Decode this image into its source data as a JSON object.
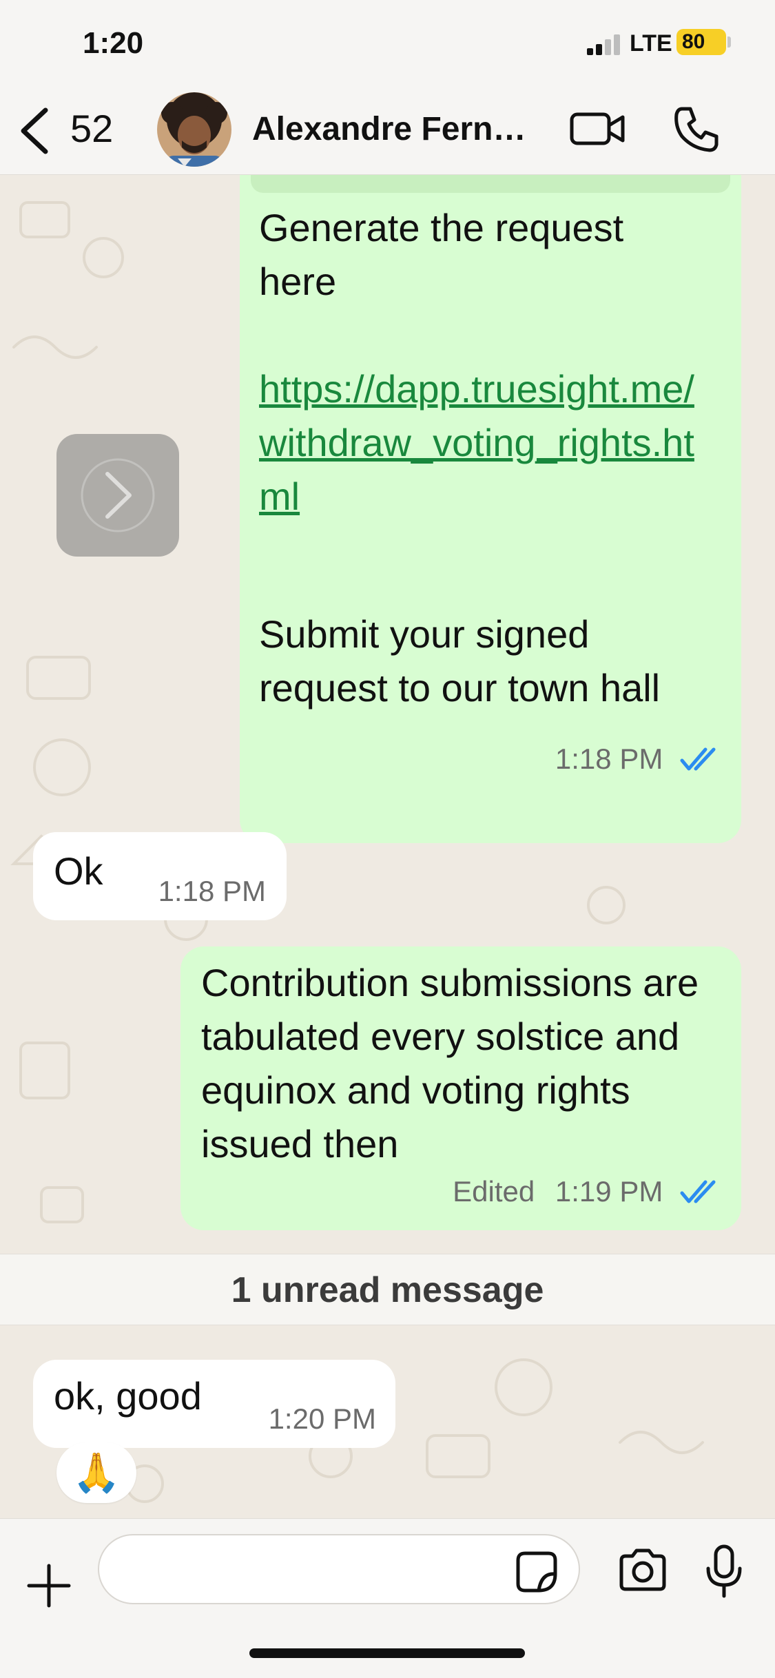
{
  "status_bar": {
    "time": "1:20",
    "network": "LTE",
    "battery": "80",
    "battery_color": "#f7cf26"
  },
  "header": {
    "back_count": "52",
    "contact_name": "Alexandre Fernandes",
    "icons": [
      "chevron-left-icon",
      "video-call-icon",
      "phone-call-icon"
    ]
  },
  "messages": [
    {
      "direction": "outgoing",
      "text_1": "Generate the request here",
      "link": "https://dapp.truesight.me/withdraw_voting_rights.html",
      "text_2": "Submit your signed request to our town hall",
      "time": "1:18 PM",
      "status": "read"
    },
    {
      "direction": "incoming",
      "text": "Ok",
      "time": "1:18 PM"
    },
    {
      "direction": "outgoing",
      "text": "Contribution submissions are tabulated every solstice and equinox and voting rights issued then",
      "edited_label": "Edited",
      "time": "1:19 PM",
      "status": "read"
    },
    {
      "direction": "incoming",
      "text": "ok, good",
      "time": "1:20 PM",
      "reaction": "🙏"
    }
  ],
  "unread_divider": "1 unread message",
  "composer": {
    "placeholder": "",
    "icons": [
      "plus-icon",
      "sticker-icon",
      "camera-icon",
      "microphone-icon"
    ]
  },
  "colors": {
    "outgoing_bubble": "#d8fdd2",
    "incoming_bubble": "#ffffff",
    "link": "#19883d",
    "read_ticks": "#2b8cf0",
    "chat_background": "#efeae2"
  }
}
